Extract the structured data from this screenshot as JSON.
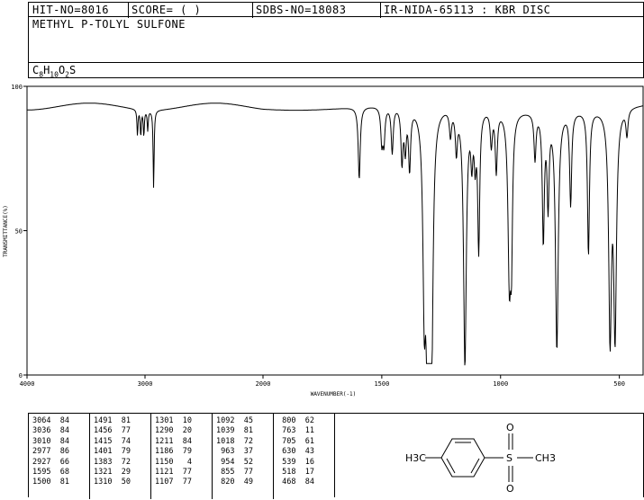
{
  "header": {
    "hit_no": "HIT-NO=8016",
    "score": "SCORE=  (   )",
    "sdbs_no": "SDBS-NO=18083",
    "ir_nida": "IR-NIDA-65113 : KBR DISC"
  },
  "compound_name": "METHYL P-TOLYL SULFONE",
  "formula": {
    "c": "C",
    "c_n": "8",
    "h": "H",
    "h_n": "10",
    "o": "O",
    "o_n": "2",
    "s": "S"
  },
  "structure_labels": {
    "left": "H3C",
    "s": "S",
    "o_top": "O",
    "o_bottom": "O",
    "right": "CH3"
  },
  "chart_data": {
    "type": "line",
    "xlabel": "WAVENUMBER(-1)",
    "ylabel": "TRANSMITTANCE(%)",
    "xlim": [
      4000,
      400
    ],
    "ylim": [
      0,
      100
    ],
    "x_ticks": [
      4000,
      3000,
      2000,
      1500,
      1000,
      500
    ],
    "y_ticks": [
      0,
      50,
      100
    ],
    "baseline": 93,
    "peaks": [
      {
        "x": 3064,
        "y": 84
      },
      {
        "x": 3036,
        "y": 84
      },
      {
        "x": 3010,
        "y": 84
      },
      {
        "x": 2977,
        "y": 86
      },
      {
        "x": 2927,
        "y": 66
      },
      {
        "x": 1595,
        "y": 68
      },
      {
        "x": 1500,
        "y": 81
      },
      {
        "x": 1491,
        "y": 81
      },
      {
        "x": 1456,
        "y": 77
      },
      {
        "x": 1415,
        "y": 74
      },
      {
        "x": 1401,
        "y": 79
      },
      {
        "x": 1383,
        "y": 72
      },
      {
        "x": 1321,
        "y": 29
      },
      {
        "x": 1310,
        "y": 50
      },
      {
        "x": 1301,
        "y": 10
      },
      {
        "x": 1290,
        "y": 20
      },
      {
        "x": 1211,
        "y": 84
      },
      {
        "x": 1186,
        "y": 79
      },
      {
        "x": 1150,
        "y": 4
      },
      {
        "x": 1121,
        "y": 77
      },
      {
        "x": 1107,
        "y": 77
      },
      {
        "x": 1092,
        "y": 45
      },
      {
        "x": 1039,
        "y": 81
      },
      {
        "x": 1018,
        "y": 72
      },
      {
        "x": 963,
        "y": 37
      },
      {
        "x": 954,
        "y": 52
      },
      {
        "x": 855,
        "y": 77
      },
      {
        "x": 820,
        "y": 49
      },
      {
        "x": 800,
        "y": 62
      },
      {
        "x": 763,
        "y": 11
      },
      {
        "x": 705,
        "y": 61
      },
      {
        "x": 630,
        "y": 43
      },
      {
        "x": 539,
        "y": 16
      },
      {
        "x": 518,
        "y": 17
      },
      {
        "x": 468,
        "y": 84
      }
    ]
  },
  "peak_table": [
    [
      [
        "3064",
        "84"
      ],
      [
        "3036",
        "84"
      ],
      [
        "3010",
        "84"
      ],
      [
        "2977",
        "86"
      ],
      [
        "2927",
        "66"
      ],
      [
        "1595",
        "68"
      ],
      [
        "1500",
        "81"
      ]
    ],
    [
      [
        "1491",
        "81"
      ],
      [
        "1456",
        "77"
      ],
      [
        "1415",
        "74"
      ],
      [
        "1401",
        "79"
      ],
      [
        "1383",
        "72"
      ],
      [
        "1321",
        "29"
      ],
      [
        "1310",
        "50"
      ]
    ],
    [
      [
        "1301",
        "10"
      ],
      [
        "1290",
        "20"
      ],
      [
        "1211",
        "84"
      ],
      [
        "1186",
        "79"
      ],
      [
        "1150",
        "4"
      ],
      [
        "1121",
        "77"
      ],
      [
        "1107",
        "77"
      ]
    ],
    [
      [
        "1092",
        "45"
      ],
      [
        "1039",
        "81"
      ],
      [
        "1018",
        "72"
      ],
      [
        "963",
        "37"
      ],
      [
        "954",
        "52"
      ],
      [
        "855",
        "77"
      ],
      [
        "820",
        "49"
      ]
    ],
    [
      [
        "800",
        "62"
      ],
      [
        "763",
        "11"
      ],
      [
        "705",
        "61"
      ],
      [
        "630",
        "43"
      ],
      [
        "539",
        "16"
      ],
      [
        "518",
        "17"
      ],
      [
        "468",
        "84"
      ]
    ]
  ]
}
